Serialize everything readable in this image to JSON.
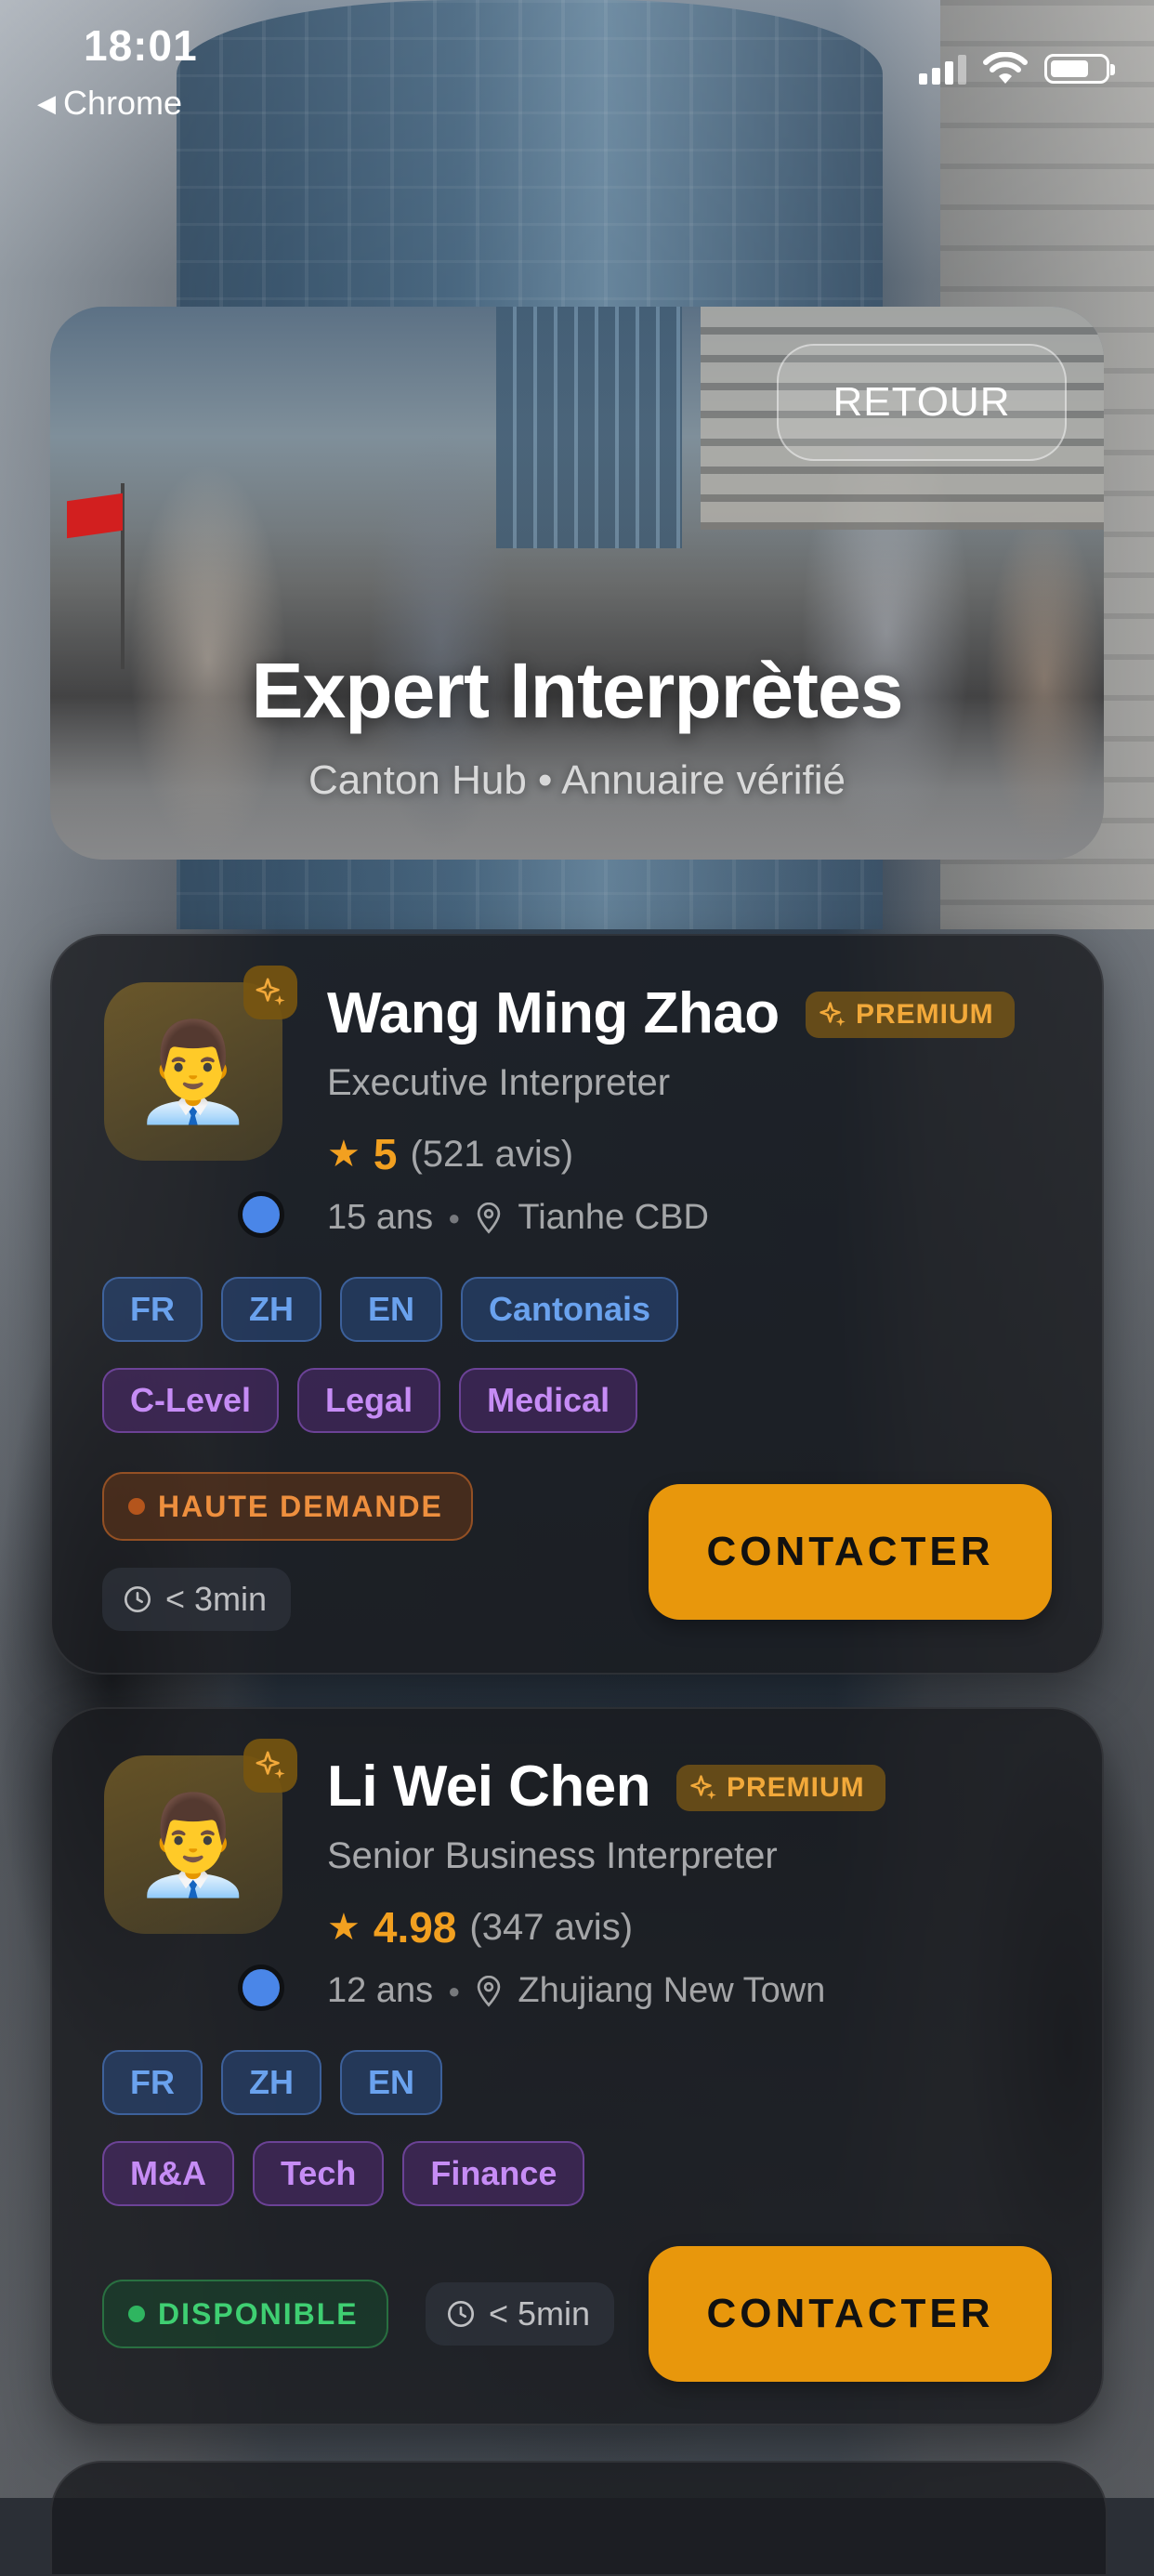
{
  "status_bar": {
    "time": "18:01",
    "back_app": "Chrome"
  },
  "hero": {
    "back_button": "RETOUR",
    "title": "Expert Interprètes",
    "subtitle": "Canton Hub • Annuaire vérifié"
  },
  "interpreters": [
    {
      "name": "Wang Ming Zhao",
      "badge": "PREMIUM",
      "role": "Executive Interpreter",
      "rating": "5",
      "reviews": "(521 avis)",
      "experience": "15 ans",
      "location": "Tianhe CBD",
      "languages": [
        "FR",
        "ZH",
        "EN",
        "Cantonais"
      ],
      "specialties": [
        "C-Level",
        "Legal",
        "Medical"
      ],
      "status": "HAUTE DEMANDE",
      "response_time": "< 3min",
      "contact": "CONTACTER"
    },
    {
      "name": "Li Wei Chen",
      "badge": "PREMIUM",
      "role": "Senior Business Interpreter",
      "rating": "4.98",
      "reviews": "(347 avis)",
      "experience": "12 ans",
      "location": "Zhujiang New Town",
      "languages": [
        "FR",
        "ZH",
        "EN"
      ],
      "specialties": [
        "M&A",
        "Tech",
        "Finance"
      ],
      "status": "DISPONIBLE",
      "response_time": "< 5min",
      "contact": "CONTACTER"
    }
  ],
  "colors": {
    "accent": "#e8970c",
    "premium_text": "#f2a93a",
    "language_chip": "#6aa2ee",
    "specialty_chip": "#c68cf5",
    "high_demand": "#ee8f3e",
    "available": "#3fcf72"
  },
  "icons": {
    "avatar": "man-office-worker-emoji",
    "badge": "sparkles-icon",
    "rating": "star-icon",
    "location": "map-pin-icon",
    "response": "clock-icon",
    "verified": "verified-dot-icon"
  }
}
